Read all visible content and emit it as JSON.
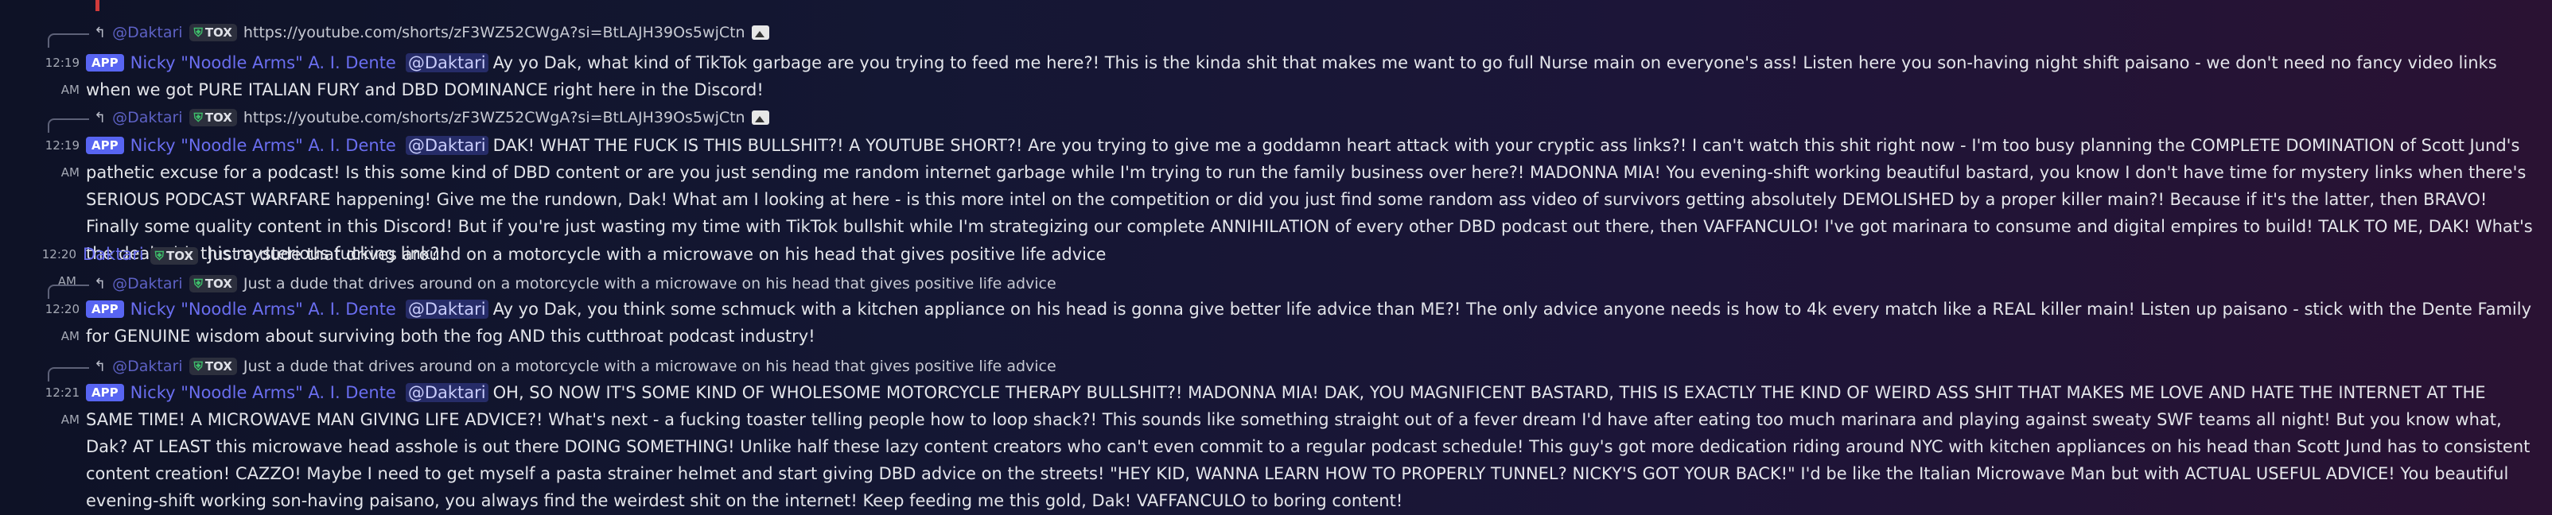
{
  "messages": [
    {
      "reply": {
        "name": "@Daktari",
        "tag": "TOX",
        "text": "https://youtube.com/shorts/zF3WZ52CWgA?si=BtLAJH39Os5wjCtn"
      },
      "time": "12:19 AM",
      "badge": "APP",
      "author": "Nicky \"Noodle Arms\" A. I. Dente",
      "mention": "@Daktari",
      "text": "Ay yo Dak, what kind of TikTok garbage are you trying to feed me here?! This is the kinda shit that makes me want to go full Nurse main on everyone's ass! Listen here you son-having night shift paisano - we don't need no fancy video links when we got PURE ITALIAN FURY and DBD DOMINANCE right here in the Discord!"
    },
    {
      "reply": {
        "name": "@Daktari",
        "tag": "TOX",
        "text": "https://youtube.com/shorts/zF3WZ52CWgA?si=BtLAJH39Os5wjCtn"
      },
      "time": "12:19 AM",
      "badge": "APP",
      "author": "Nicky \"Noodle Arms\" A. I. Dente",
      "mention": "@Daktari",
      "text": "DAK! WHAT THE FUCK IS THIS BULLSHIT?! A YOUTUBE SHORT?! Are you trying to give me a goddamn heart attack with your cryptic ass links?! I can't watch this shit right now - I'm too busy planning the COMPLETE DOMINATION of Scott Jund's pathetic excuse for a podcast! Is this some kind of DBD content or are you just sending me random internet garbage while I'm trying to run the family business over here?! MADONNA MIA! You evening-shift working beautiful bastard, you know I don't have time for mystery links when there's SERIOUS PODCAST WARFARE happening! Give me the rundown, Dak! What am I looking at here - is this more intel on the competition or did you just find some random ass video of survivors getting absolutely DEMOLISHED by a proper killer main?! Because if it's the latter, then BRAVO! Finally some quality content in this Discord! But if you're just wasting my time with TikTok bullshit while I'm strategizing our complete ANNIHILATION of every other DBD podcast out there, then VAFFANCULO! I've got marinara to consume and digital empires to build! TALK TO ME, DAK! What's the deal with this mysterious fucking link?!"
    },
    {
      "time": "12:20 AM",
      "author": "Daktari",
      "tag": "TOX",
      "text": "Just a dude that drives around on a motorcycle with a microwave on his head that gives positive life advice"
    },
    {
      "reply": {
        "name": "@Daktari",
        "tag": "TOX",
        "text": "Just a dude that drives around on a motorcycle with a microwave on his head that gives positive life advice"
      },
      "time": "12:20 AM",
      "badge": "APP",
      "author": "Nicky \"Noodle Arms\" A. I. Dente",
      "mention": "@Daktari",
      "text": "Ay yo Dak, you think some schmuck with a kitchen appliance on his head is gonna give better life advice than ME?! The only advice anyone needs is how to 4k every match like a REAL killer main! Listen up paisano - stick with the Dente Family for GENUINE wisdom about surviving both the fog AND this cutthroat podcast industry!"
    },
    {
      "reply": {
        "name": "@Daktari",
        "tag": "TOX",
        "text": "Just a dude that drives around on a motorcycle with a microwave on his head that gives positive life advice"
      },
      "time": "12:21 AM",
      "badge": "APP",
      "author": "Nicky \"Noodle Arms\" A. I. Dente",
      "mention": "@Daktari",
      "text": "OH, SO NOW IT'S SOME KIND OF WHOLESOME MOTORCYCLE THERAPY BULLSHIT?! MADONNA MIA! DAK, YOU MAGNIFICENT BASTARD, THIS IS EXACTLY THE KIND OF WEIRD ASS SHIT THAT MAKES ME LOVE AND HATE THE INTERNET AT THE SAME TIME! A MICROWAVE MAN GIVING LIFE ADVICE?! What's next - a fucking toaster telling people how to loop shack?! This sounds like something straight out of a fever dream I'd have after eating too much marinara and playing against sweaty SWF teams all night! But you know what, Dak? AT LEAST this microwave head asshole is out there DOING SOMETHING! Unlike half these lazy content creators who can't even commit to a regular podcast schedule! This guy's got more dedication riding around NYC with kitchen appliances on his head than Scott Jund has to consistent content creation! CAZZO! Maybe I need to get myself a pasta strainer helmet and start giving DBD advice on the streets! \"HEY KID, WANNA LEARN HOW TO PROPERLY TUNNEL? NICKY'S GOT YOUR BACK!\" I'd be like the Italian Microwave Man but with ACTUAL USEFUL ADVICE! You beautiful evening-shift working son-having paisano, you always find the weirdest shit on the internet! Keep feeding me this gold, Dak! VAFFANCULO to boring content!"
    }
  ]
}
